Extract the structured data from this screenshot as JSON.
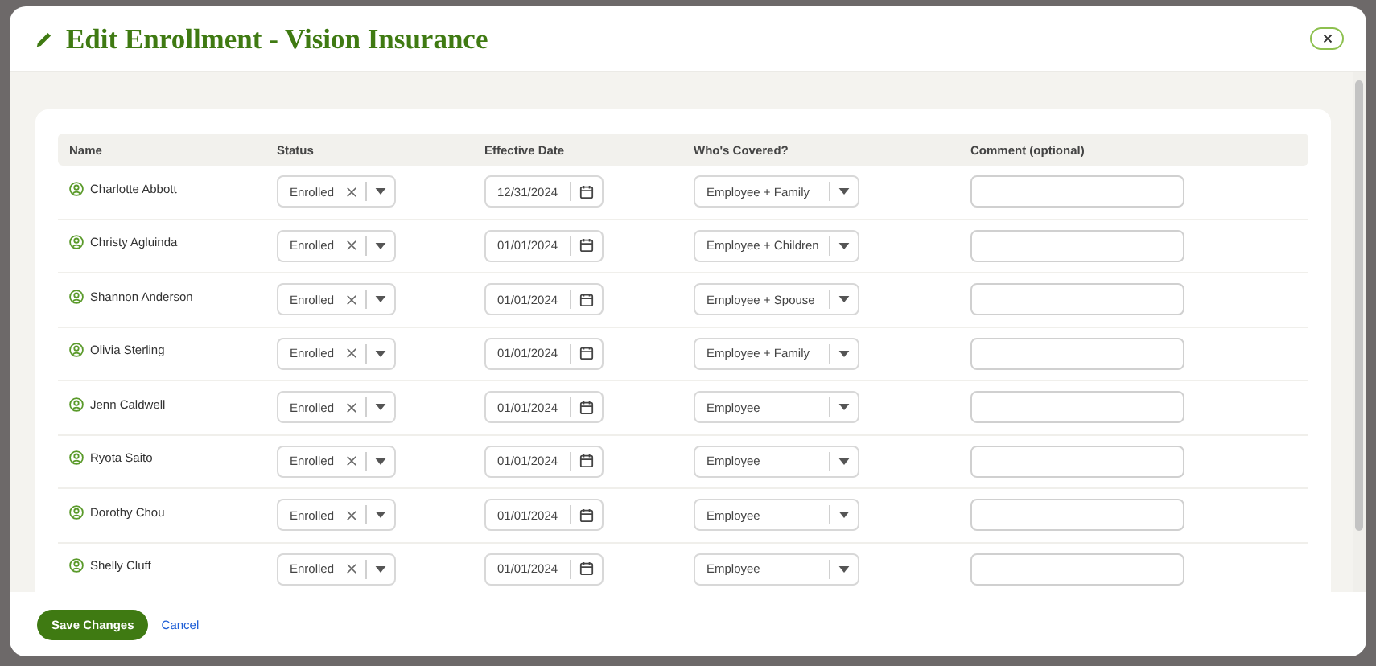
{
  "dialog": {
    "title": "Edit Enrollment - Vision Insurance"
  },
  "table": {
    "columns": [
      "Name",
      "Status",
      "Effective Date",
      "Who's Covered?",
      "Comment (optional)"
    ],
    "rows": [
      {
        "name": "Charlotte Abbott",
        "status": "Enrolled",
        "date": "12/31/2024",
        "covered": "Employee + Family"
      },
      {
        "name": "Christy Agluinda",
        "status": "Enrolled",
        "date": "01/01/2024",
        "covered": "Employee + Children"
      },
      {
        "name": "Shannon Anderson",
        "status": "Enrolled",
        "date": "01/01/2024",
        "covered": "Employee + Spouse"
      },
      {
        "name": "Olivia Sterling",
        "status": "Enrolled",
        "date": "01/01/2024",
        "covered": "Employee + Family"
      },
      {
        "name": "Jenn Caldwell",
        "status": "Enrolled",
        "date": "01/01/2024",
        "covered": "Employee"
      },
      {
        "name": "Ryota Saito",
        "status": "Enrolled",
        "date": "01/01/2024",
        "covered": "Employee"
      },
      {
        "name": "Dorothy Chou",
        "status": "Enrolled",
        "date": "01/01/2024",
        "covered": "Employee"
      },
      {
        "name": "Shelly Cluff",
        "status": "Enrolled",
        "date": "01/01/2024",
        "covered": "Employee"
      }
    ]
  },
  "footer": {
    "save": "Save Changes",
    "cancel": "Cancel"
  }
}
